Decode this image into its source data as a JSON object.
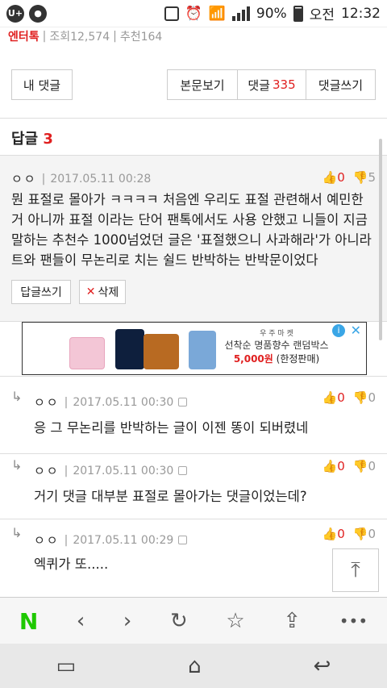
{
  "status": {
    "battery": "90%",
    "ampm": "오전",
    "time": "12:32"
  },
  "meta": {
    "category": "엔터톡",
    "views": "조회12,574",
    "recommend": "추천164"
  },
  "nav": {
    "my_comments": "내 댓글",
    "view_post": "본문보기",
    "comments_label": "댓글",
    "comments_count": "335",
    "write_comment": "댓글쓰기"
  },
  "replies_title": {
    "label": "답글",
    "count": "3"
  },
  "main_comment": {
    "nick": "ㅇㅇ",
    "date": "2017.05.11 00:28",
    "up": "0",
    "down": "5",
    "text": "뭔 표절로 몰아가 ㅋㅋㅋㅋ 처음엔 우리도 표절 관련해서 예민한 거 아니까 표절 이라는 단어 팬톡에서도 사용 안했고 니들이 지금 말하는 추천수 1000넘었던 글은 '표절했으니 사과해라'가 아니라트와 팬들이 무논리로 치는 쉴드 반박하는 반박문이었다",
    "reply_button": "답글쓰기",
    "delete_button": "삭제"
  },
  "ad": {
    "brand": "우 주 마 켓",
    "line1": "선착순 명품향수 랜덤박스",
    "line2": "5,000원",
    "line3": "(한정판매)"
  },
  "replies": [
    {
      "nick": "ㅇㅇ",
      "date": "2017.05.11 00:30",
      "up": "0",
      "down": "0",
      "text": "응 그 무논리를 반박하는 글이 이젠 똥이 되버렸네"
    },
    {
      "nick": "ㅇㅇ",
      "date": "2017.05.11 00:30",
      "up": "0",
      "down": "0",
      "text": "거기 댓글 대부분 표절로 몰아가는 댓글이었는데?"
    },
    {
      "nick": "ㅇㅇ",
      "date": "2017.05.11 00:29",
      "up": "0",
      "down": "0",
      "text": "엑퀴가 또....."
    }
  ]
}
